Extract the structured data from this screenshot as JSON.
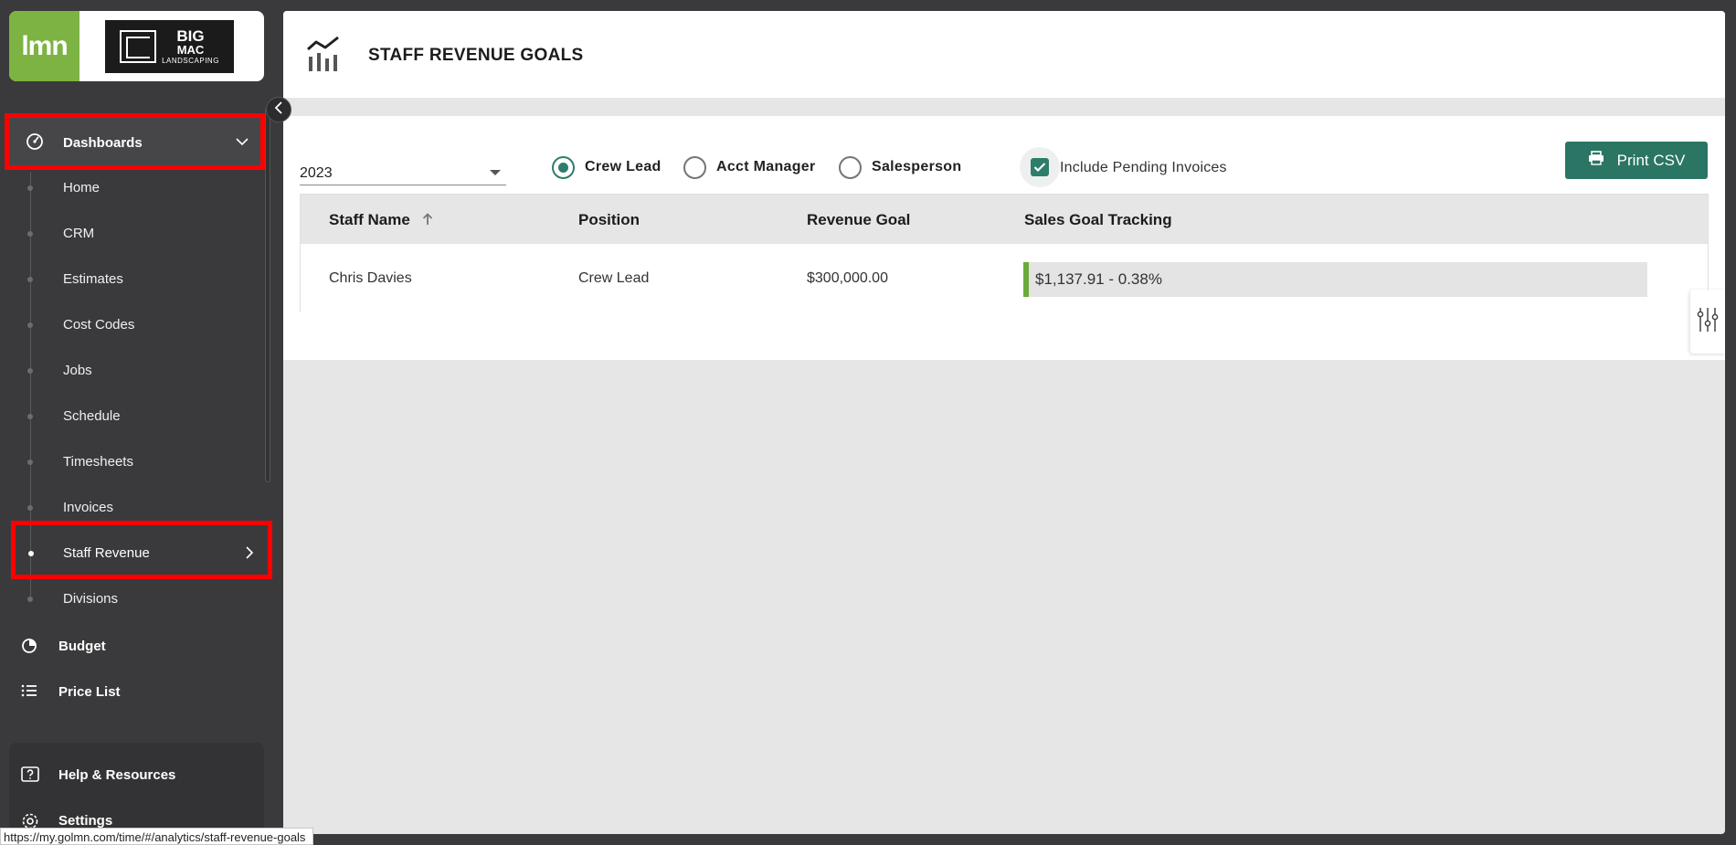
{
  "brand": {
    "app_logo": "lmn",
    "company_line1": "BIG",
    "company_line2": "MAC",
    "company_line3": "LANDSCAPING"
  },
  "sidebar": {
    "group": {
      "label": "Dashboards",
      "icon": "dashboard-gauge-icon",
      "expanded": true
    },
    "sub_items": [
      {
        "label": "Home"
      },
      {
        "label": "CRM"
      },
      {
        "label": "Estimates"
      },
      {
        "label": "Cost Codes"
      },
      {
        "label": "Jobs"
      },
      {
        "label": "Schedule"
      },
      {
        "label": "Timesheets"
      },
      {
        "label": "Invoices"
      },
      {
        "label": "Staff Revenue",
        "active": true
      },
      {
        "label": "Divisions"
      }
    ],
    "main_items": [
      {
        "label": "Budget",
        "icon": "pie-chart-icon"
      },
      {
        "label": "Price List",
        "icon": "list-icon"
      }
    ],
    "bottom_items": [
      {
        "label": "Help & Resources",
        "icon": "help-icon"
      },
      {
        "label": "Settings",
        "icon": "gear-icon"
      }
    ]
  },
  "status_bar": {
    "url": "https://my.golmn.com/time/#/analytics/staff-revenue-goals"
  },
  "header": {
    "title": "STAFF REVENUE GOALS",
    "icon": "analytics-chart-icon"
  },
  "filters": {
    "year": "2023",
    "roles": [
      {
        "label": "Crew Lead",
        "selected": true
      },
      {
        "label": "Acct Manager",
        "selected": false
      },
      {
        "label": "Salesperson",
        "selected": false
      }
    ],
    "include_pending_label": "Include Pending Invoices",
    "include_pending_checked": true,
    "print_label": "Print CSV"
  },
  "table": {
    "columns": [
      "Staff Name",
      "Position",
      "Revenue Goal",
      "Sales Goal Tracking"
    ],
    "sort": {
      "column": "Staff Name",
      "direction": "ascending"
    },
    "rows": [
      {
        "name": "Chris Davies",
        "position": "Crew Lead",
        "goal": "$300,000.00",
        "tracking": "$1,137.91 - 0.38%",
        "tracking_percent": 0.38
      }
    ]
  },
  "colors": {
    "accent": "#2a7563",
    "lmn_green": "#7cb342",
    "progress_green": "#6aaa3a",
    "highlight": "#ff0000",
    "sidebar_bg": "#3a3a3c"
  }
}
